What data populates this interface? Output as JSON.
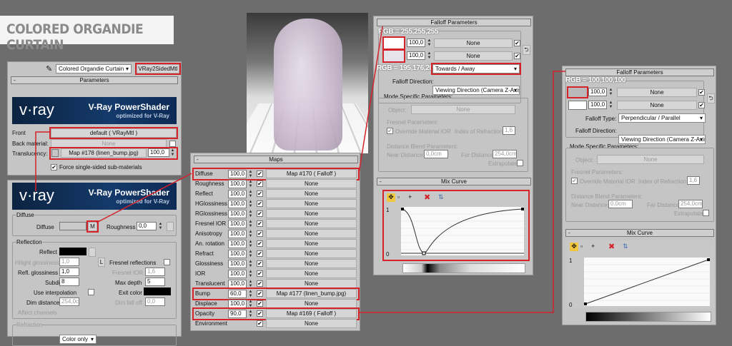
{
  "banner": {
    "title": "COLORED ORGANDIE CURTAIN"
  },
  "material": {
    "name": "Colored Organdie Curtain",
    "type": "VRay2SidedMtl",
    "params_title": "Parameters",
    "vray_title": "V-Ray PowerShader",
    "vray_sub": "optimized for V-Ray",
    "vray_logo": "v·ray",
    "front_label": "Front",
    "front_value": "default ( VRayMtl )",
    "back_label": "Back material:",
    "back_value": "None",
    "transl_label": "Translucency:",
    "transl_value": "Map #178 (linen_bump.jpg)",
    "transl_amount": "100,0",
    "force_label": "Force single-sided sub-materials"
  },
  "vraymtl": {
    "diffuse_group": "Diffuse",
    "diffuse_label": "Diffuse",
    "m_label": "M",
    "roughness_label": "Roughness",
    "roughness": "0,0",
    "reflection_group": "Reflection",
    "reflect_label": "Reflect",
    "hilight_label": "Hilight glossiness",
    "hilight": "1,0",
    "l_label": "L",
    "fresnel_label": "Fresnel reflections",
    "refl_gloss_label": "Refl. glossiness",
    "refl_gloss": "1,0",
    "fresnel_ior_label": "Fresnel IOR",
    "fresnel_ior": "1,6",
    "subdivs_label": "Subdivs",
    "subdivs": "8",
    "maxdepth_label": "Max depth",
    "maxdepth": "5",
    "interp_label": "Use interpolation",
    "exit_label": "Exit color",
    "dim_label": "Dim distance",
    "dim": "254,0c",
    "dimfall_label": "Dim fall off",
    "dimfall": "0,0",
    "affect_label": "Affect channels",
    "affect": "Color only",
    "refraction_group": "Refraction"
  },
  "maps": {
    "title": "Maps",
    "rows": [
      {
        "name": "Diffuse",
        "amount": "100,0",
        "map": "Map #170 ( Falloff )",
        "hl": true
      },
      {
        "name": "Roughness",
        "amount": "100,0",
        "map": "None"
      },
      {
        "name": "Reflect",
        "amount": "100,0",
        "map": "None"
      },
      {
        "name": "HGlossiness",
        "amount": "100,0",
        "map": "None"
      },
      {
        "name": "RGlossiness",
        "amount": "100,0",
        "map": "None"
      },
      {
        "name": "Fresnel IOR",
        "amount": "100,0",
        "map": "None"
      },
      {
        "name": "Anisotropy",
        "amount": "100,0",
        "map": "None"
      },
      {
        "name": "An. rotation",
        "amount": "100,0",
        "map": "None"
      },
      {
        "name": "Refract",
        "amount": "100,0",
        "map": "None"
      },
      {
        "name": "Glossiness",
        "amount": "100,0",
        "map": "None"
      },
      {
        "name": "IOR",
        "amount": "100,0",
        "map": "None"
      },
      {
        "name": "Translucent",
        "amount": "100,0",
        "map": "None"
      },
      {
        "name": "Bump",
        "amount": "60,0",
        "map": "Map #177 (linen_bump.jpg)",
        "hl": true
      },
      {
        "name": "Displace",
        "amount": "100,0",
        "map": "None"
      },
      {
        "name": "Opacity",
        "amount": "90,0",
        "map": "Map #169 ( Falloff )",
        "hl": true
      },
      {
        "name": "Environment",
        "amount": "",
        "map": "None"
      }
    ]
  },
  "falloff1": {
    "title": "Falloff Parameters",
    "rgb_top": "RGB = 255,255,255",
    "rgb_bottom": "RGB = 195,176,200",
    "color1": "#ffffff",
    "color2": "#c3b0c8",
    "amount1": "100,0",
    "amount2": "100,0",
    "map1": "None",
    "map2": "None",
    "type": "Towards / Away",
    "dir_label": "Falloff Direction:",
    "dir": "Viewing Direction (Camera Z-Axis)",
    "mode_label": "Mode Specific Parameters:",
    "object_label": "Object:",
    "object": "None",
    "fresnel_label": "Fresnel Parameters:",
    "override_label": "Override Material IOR",
    "ior_label": "Index of Refraction",
    "ior": "1,6",
    "dist_label": "Distance Blend Parameters:",
    "near_label": "Near Distance:",
    "near": "0,0cm",
    "far_label": "Far Distance:",
    "far": "254,0cm",
    "extrap_label": "Extrapolate",
    "curve_title": "Mix Curve",
    "y1": "1",
    "y0": "0"
  },
  "falloff2": {
    "title": "Falloff Parameters",
    "rgb_top": "RGB = 100,100,100",
    "color1": "#b9b9b9",
    "color2": "#ffffff",
    "amount1": "100,0",
    "amount2": "100,0",
    "map1": "None",
    "map2": "None",
    "type_label": "Falloff Type:",
    "type": "Perpendicular / Parallel",
    "dir_label": "Falloff Direction:",
    "dir": "Viewing Direction (Camera Z-Axis)",
    "mode_label": "Mode Specific Parameters:",
    "object_label": "Object:",
    "object": "None",
    "fresnel_label": "Fresnel Parameters:",
    "override_label": "Override Material IOR",
    "ior_label": "Index of Refraction",
    "ior": "1,6",
    "dist_label": "Distance Blend Parameters:",
    "near_label": "Near Distance:",
    "near": "0,0cm",
    "far_label": "Far Distance:",
    "far": "254,0cm",
    "extrap_label": "Extrapolate",
    "curve_title": "Mix Curve",
    "y1": "1",
    "y0": "0"
  },
  "colors": {
    "highlight": "#d4232a",
    "accent": "#143a6b"
  }
}
